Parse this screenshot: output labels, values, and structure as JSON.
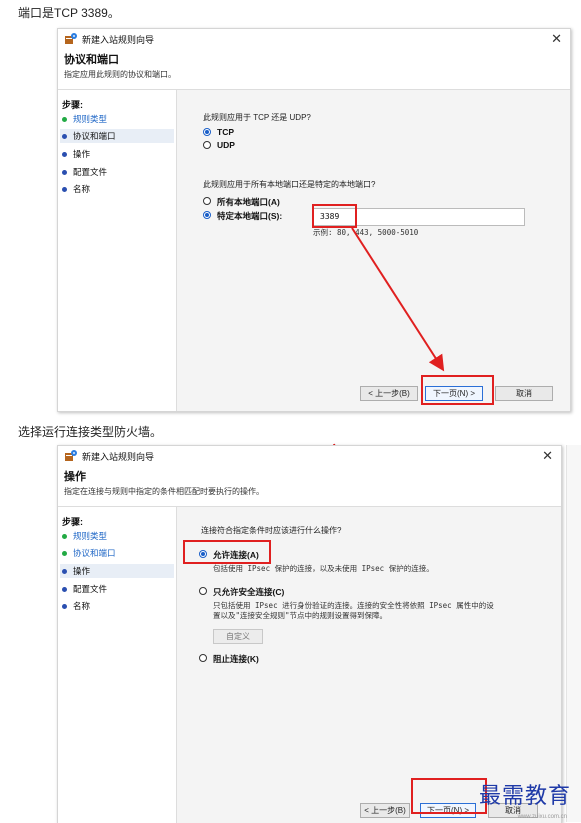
{
  "captions": {
    "first": "端口是TCP 3389。",
    "second": "选择运行连接类型防火墙。"
  },
  "dialog1": {
    "window_title": "新建入站规则向导",
    "header_title": "协议和端口",
    "header_desc": "指定应用此规则的协议和端口。",
    "steps_title": "步骤:",
    "steps": [
      "规则类型",
      "协议和端口",
      "操作",
      "配置文件",
      "名称"
    ],
    "q_protocol": "此规则应用于 TCP 还是 UDP?",
    "opt_tcp": "TCP",
    "opt_udp": "UDP",
    "q_ports": "此规则应用于所有本地端口还是特定的本地端口?",
    "opt_all_ports": "所有本地端口(A)",
    "opt_specific_ports": "特定本地端口(S):",
    "port_value": "3389",
    "port_example": "示例: 80, 443, 5000-5010",
    "btn_back": "< 上一步(B)",
    "btn_next": "下一页(N) >",
    "btn_cancel": "取消"
  },
  "dialog2": {
    "window_title": "新建入站规则向导",
    "header_title": "操作",
    "header_desc": "指定在连接与规则中指定的条件相匹配时要执行的操作。",
    "steps_title": "步骤:",
    "steps": [
      "规则类型",
      "协议和端口",
      "操作",
      "配置文件",
      "名称"
    ],
    "q_action": "连接符合指定条件时应该进行什么操作?",
    "opt_allow": "允许连接(A)",
    "opt_allow_desc": "包括使用 IPsec 保护的连接，以及未使用 IPsec 保护的连接。",
    "opt_secure": "只允许安全连接(C)",
    "opt_secure_desc_1": "只包括使用 IPsec 进行身份验证的连接。连接的安全性将依照 IPsec 属性中的设",
    "opt_secure_desc_2": "置以及\"连接安全规则\"节点中的规则设置得到保障。",
    "btn_customize": "自定义",
    "opt_block": "阻止连接(K)",
    "btn_back": "< 上一步(B)",
    "btn_next": "下一页(N) >",
    "btn_cancel": "取消"
  },
  "watermark": {
    "text": "最需教育",
    "sub": "www.zuixu.com.cn"
  },
  "colors": {
    "annotation_red": "#e02020",
    "accent_blue": "#1a5fc8",
    "link_blue": "#1e66c6",
    "done_green": "#22aa44"
  }
}
